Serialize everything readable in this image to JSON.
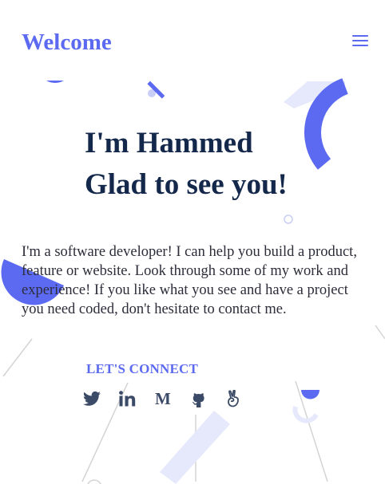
{
  "header": {
    "brand": "Welcome",
    "menu_icon": "hamburger-menu-icon"
  },
  "hero": {
    "line1": "I'm Hammed",
    "line2": "Glad to see you!"
  },
  "intro": {
    "text": "I'm a software developer! I can help you build a product, feature or website. Look through some of my work and experience! If you like what you see and have a project you need coded, don't hesitate to contact me."
  },
  "connect": {
    "heading": "LET'S CONNECT",
    "links": [
      {
        "name": "twitter",
        "icon": "twitter-icon"
      },
      {
        "name": "linkedin",
        "icon": "linkedin-icon"
      },
      {
        "name": "medium",
        "icon": "medium-icon",
        "glyph": "M"
      },
      {
        "name": "github",
        "icon": "github-icon"
      },
      {
        "name": "angellist",
        "icon": "angellist-icon"
      }
    ]
  },
  "colors": {
    "accent": "#5b6af0",
    "accent_light": "#e6e8fc",
    "heading": "#13284a",
    "body": "#2d2d3a",
    "icon": "#3b4a66"
  }
}
